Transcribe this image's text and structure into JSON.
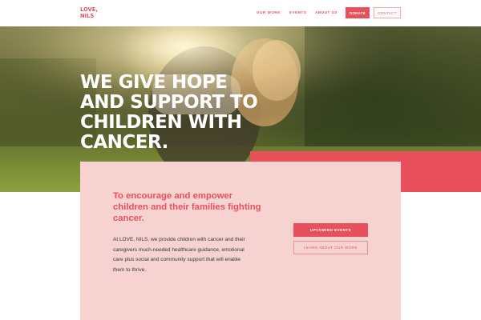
{
  "header": {
    "logo": {
      "line1": "LOVE,",
      "line2": "NILS"
    },
    "nav": {
      "our_work": "OUR WORK",
      "events": "EVENTS",
      "about_us": "ABOUT US"
    },
    "donate_label": "DONATE",
    "contact_label": "CONTACT"
  },
  "hero": {
    "headline_lines": [
      "WE GIVE HOPE",
      "AND SUPPORT TO",
      "CHILDREN WITH",
      "CANCER."
    ]
  },
  "mission": {
    "title_lines": [
      "To encourage and empower",
      "children and their families fighting",
      "cancer."
    ],
    "body_lines": [
      "At LOVE, NILS, we provide children with cancer and their",
      "caregivers much-needed healthcare guidance, emotional",
      "care plus social and community support that will enable",
      "them to thrive."
    ],
    "upcoming_events_label": "UPCOMING EVENTS",
    "learn_more_label": "LEARN ABOUT OUR WORK"
  },
  "colors": {
    "accent": "#e8505b",
    "panel": "#f6d3d1"
  }
}
